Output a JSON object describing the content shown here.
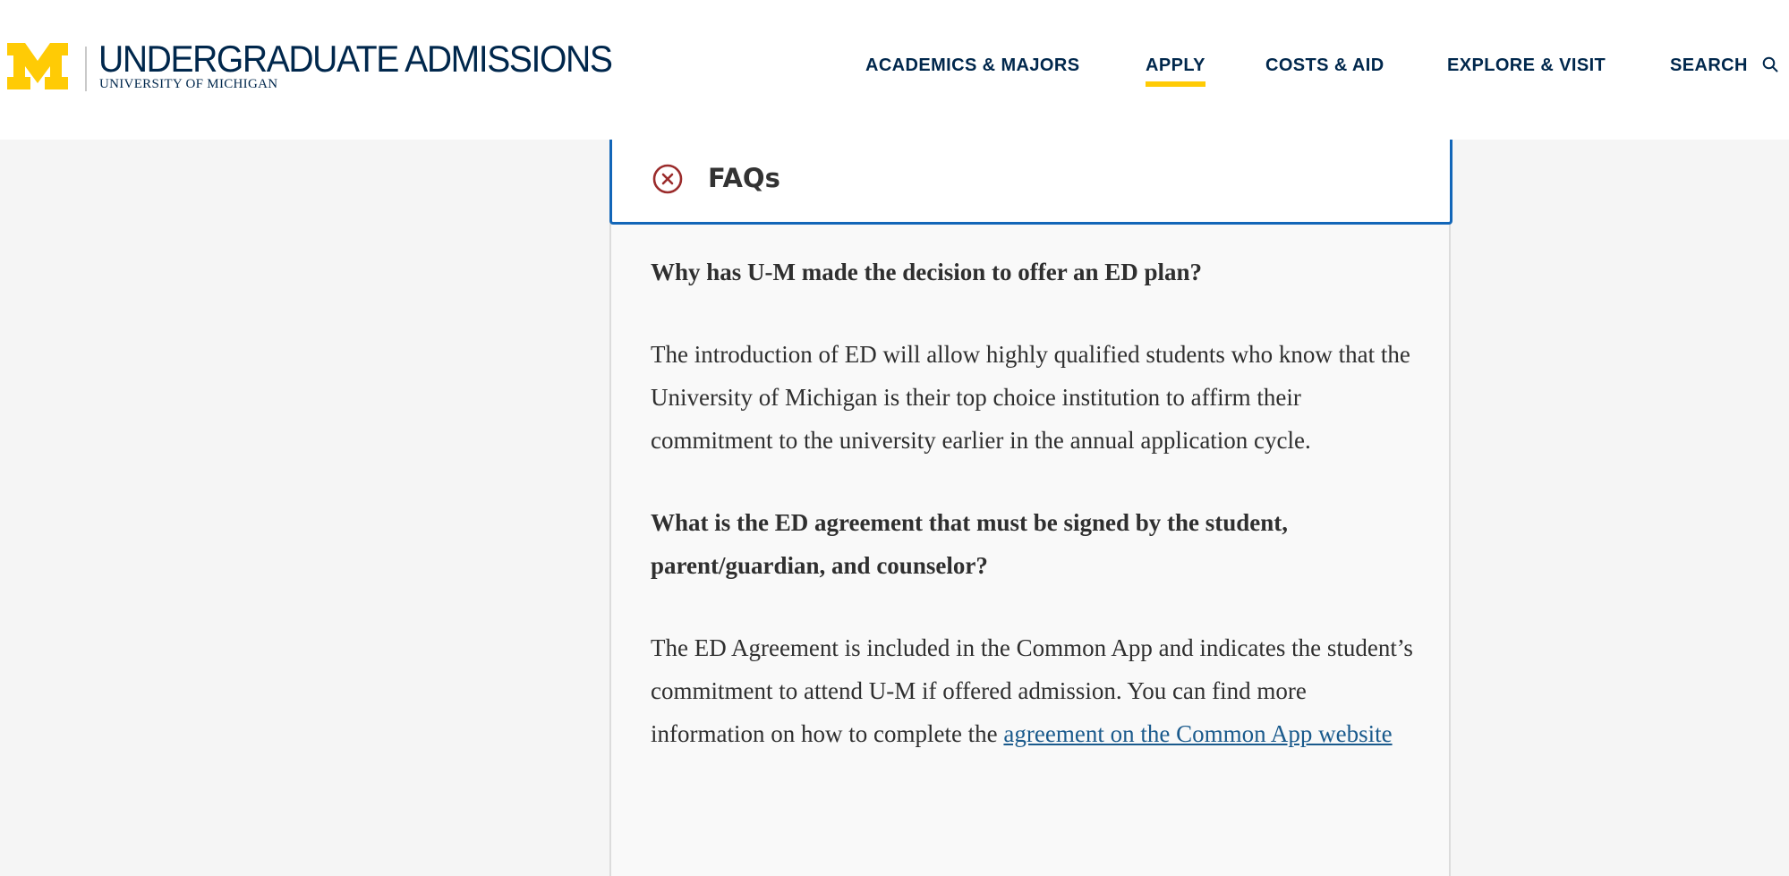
{
  "brand": {
    "logo_letter": "M",
    "title": "UNDERGRADUATE ADMISSIONS",
    "subtitle": "UNIVERSITY OF MICHIGAN",
    "maize": "#ffcb05",
    "blue": "#00274c"
  },
  "nav": {
    "items": [
      {
        "label": "ACADEMICS & MAJORS",
        "active": false
      },
      {
        "label": "APPLY",
        "active": true
      },
      {
        "label": "COSTS & AID",
        "active": false
      },
      {
        "label": "EXPLORE & VISIT",
        "active": false
      }
    ],
    "search_label": "SEARCH",
    "search_icon": "search-icon"
  },
  "faq": {
    "title": "FAQs",
    "close_icon": "close-circle-icon",
    "accent": "#1266b8",
    "close_color": "#9b2c2c",
    "items": [
      {
        "question": "Why has U-M made the decision to offer an ED plan?",
        "answer": "The introduction of ED will allow highly qualified students who know that the University of Michigan is their top choice institution to affirm their commitment to the university earlier in the annual application cycle."
      },
      {
        "question": "What is the ED agreement that must be signed by the student, parent/guardian, and counselor?",
        "answer_prefix": "The ED Agreement is included in the Common App and indicates the student’s commitment to attend U-M if offered admission. You can find more information on how to complete the ",
        "answer_link": "agreement on the Common App website"
      }
    ]
  }
}
